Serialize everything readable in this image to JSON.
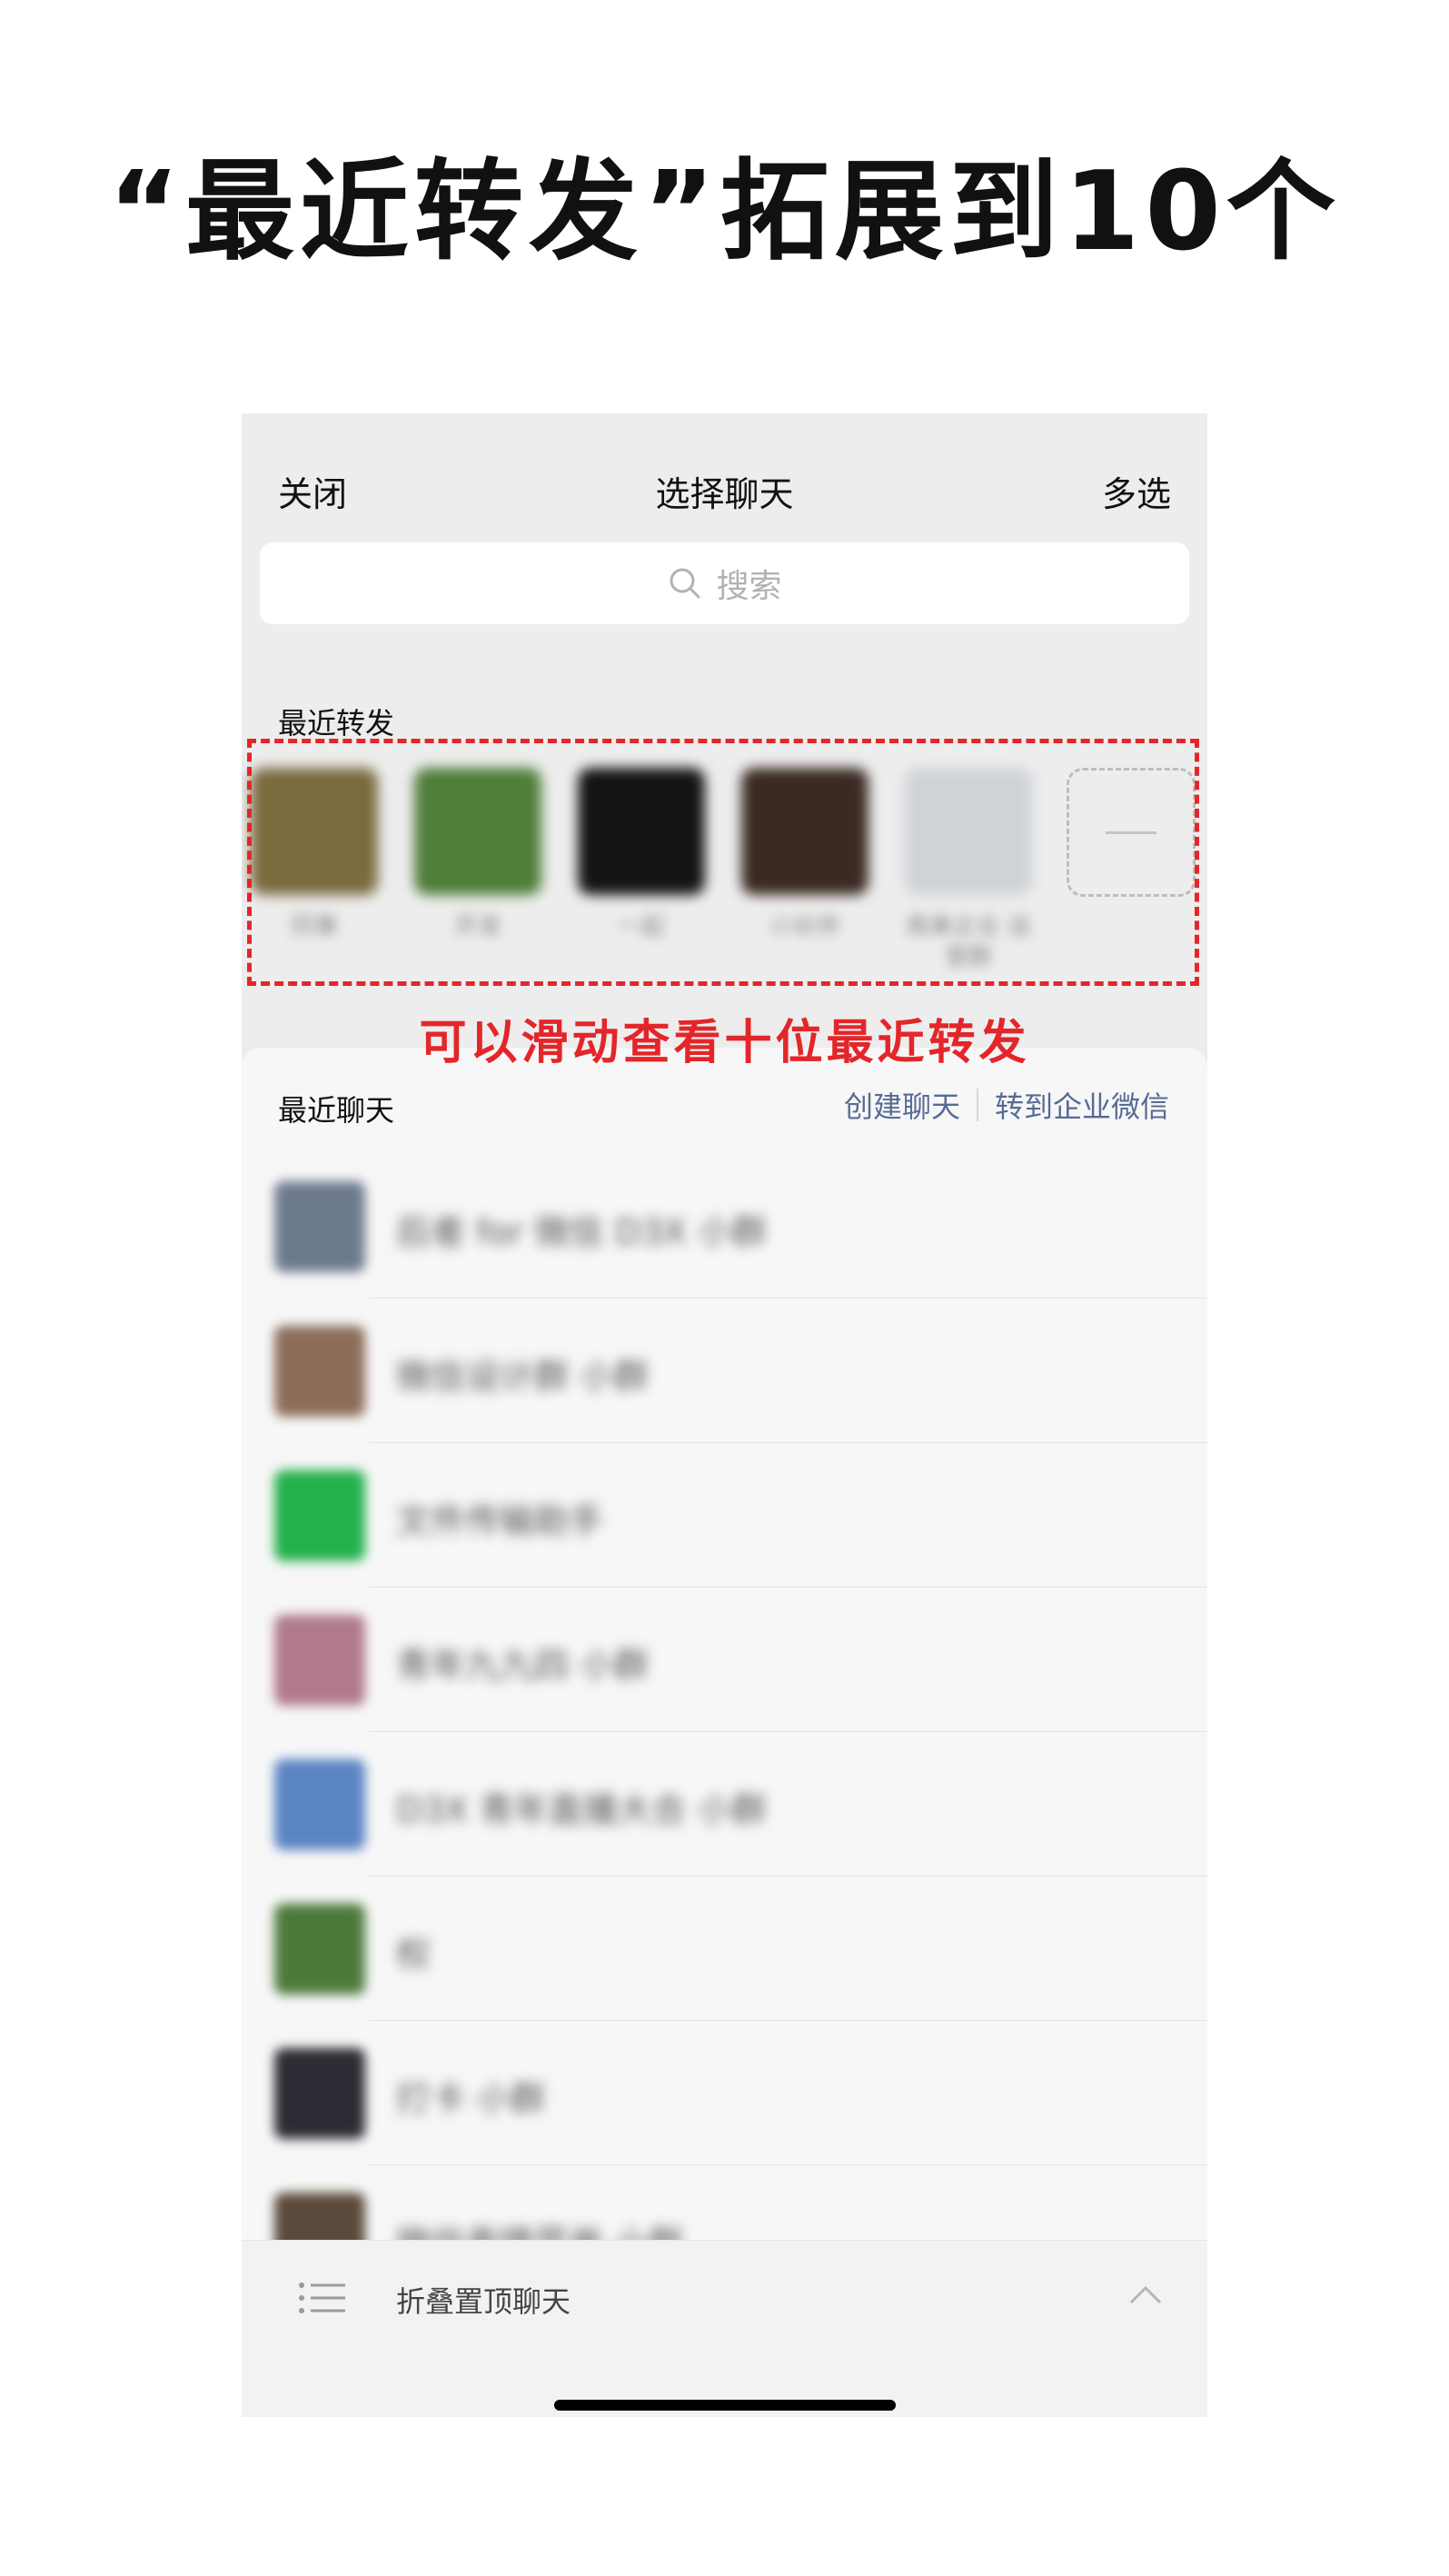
{
  "headline": "“最近转发”拓展到10个",
  "nav": {
    "close_label": "关闭",
    "title": "选择聊天",
    "multi_select_label": "多选"
  },
  "search": {
    "placeholder": "搜索",
    "icon": "search-icon"
  },
  "recent_forwards": {
    "label": "最近转发",
    "items": [
      {
        "name": "同事",
        "avatar_color": "#7a6a3e"
      },
      {
        "name": "开发",
        "avatar_color": "#4f7d3a"
      },
      {
        "name": "一起",
        "avatar_color": "#141414"
      },
      {
        "name": "小伙伴",
        "avatar_color": "#3b2a22"
      },
      {
        "name": "南美企业 运营群",
        "avatar_color": "#cfd3d8"
      }
    ],
    "more_icon": "dash-icon"
  },
  "annotation": "可以滑动查看十位最近转发",
  "recent_chats": {
    "label": "最近聊天",
    "create_chat_label": "创建聊天",
    "enterprise_label": "转到企业微信",
    "items": [
      {
        "name": "后者 for 微信 D3X 小群",
        "avatar_color": "#6d7a8e"
      },
      {
        "name": "微信设计群 小群",
        "avatar_color": "#8c6d5a"
      },
      {
        "name": "文件传输助手",
        "avatar_color": "#23b14d"
      },
      {
        "name": "青年九九四 小群",
        "avatar_color": "#b07a8c"
      },
      {
        "name": "D3X 青年直播大合 小群",
        "avatar_color": "#5a84c4"
      },
      {
        "name": "权",
        "avatar_color": "#4d7a3a"
      },
      {
        "name": "打卡 小群",
        "avatar_color": "#2c2c34"
      },
      {
        "name": "微信表情菜单 小群",
        "avatar_color": "#5b4a3c"
      }
    ]
  },
  "footer": {
    "collapse_label": "折叠置顶聊天",
    "list_icon": "list-icon",
    "chevron_icon": "chevron-up-icon"
  },
  "colors": {
    "annotation_red": "#e3262a",
    "link_blue": "#576b95"
  }
}
